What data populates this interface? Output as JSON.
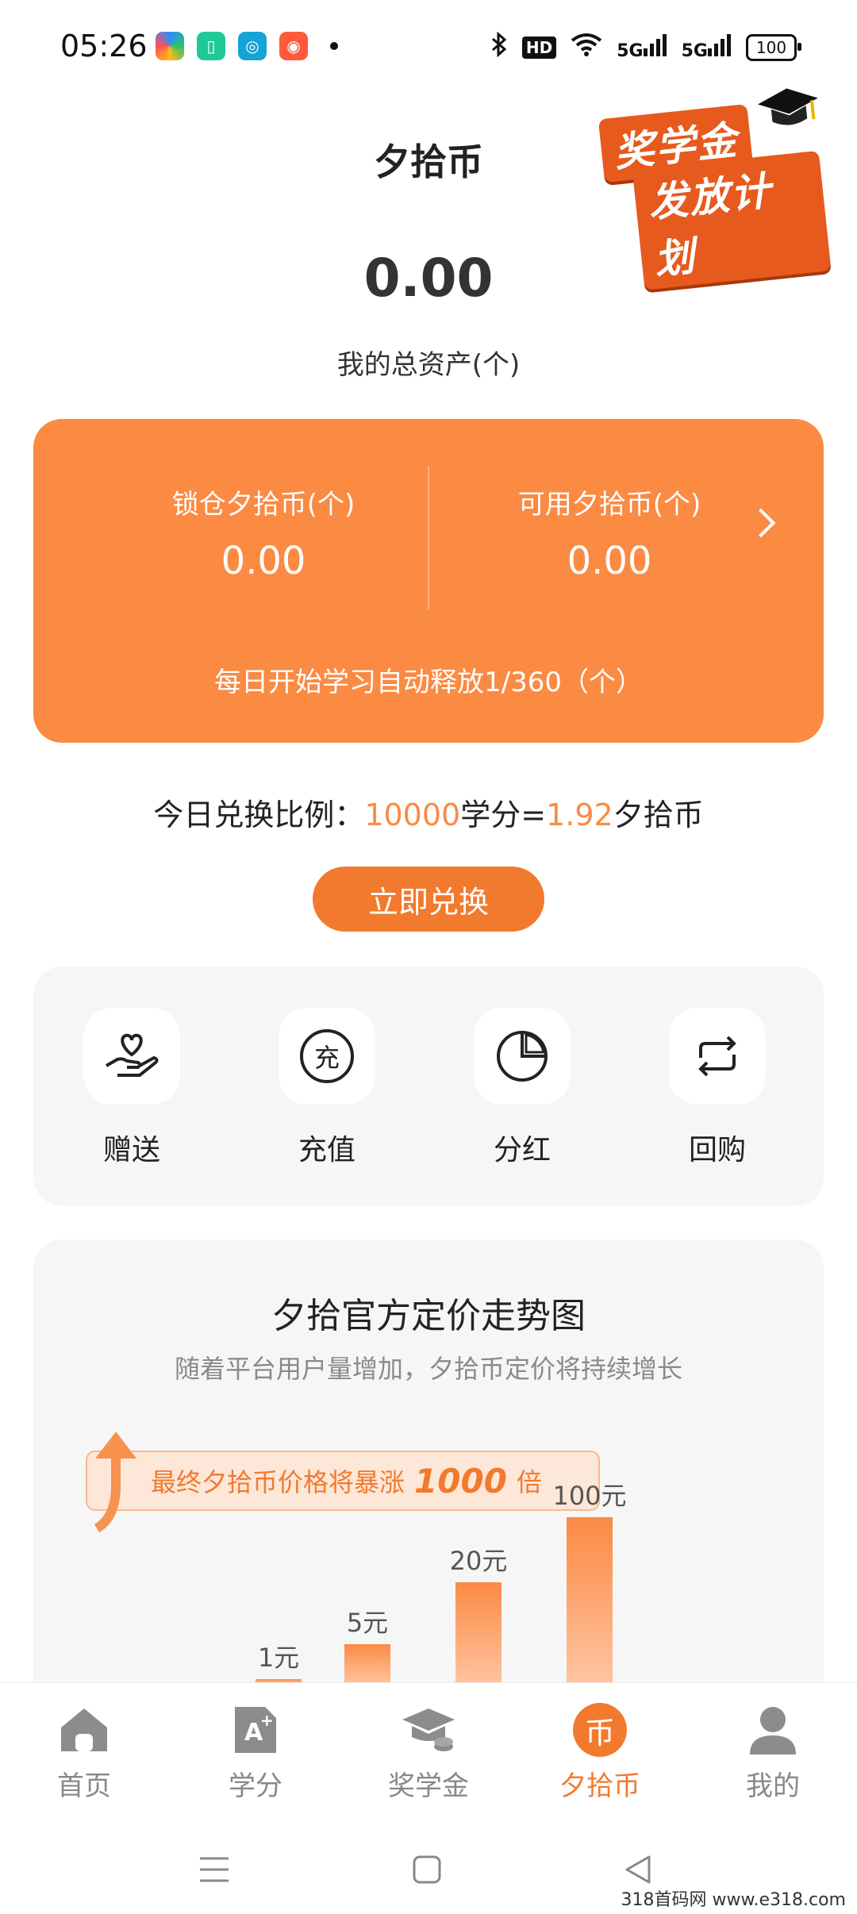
{
  "status_bar": {
    "time": "05:26",
    "notification_icons": [
      "colorful-app-icon",
      "green-app-icon",
      "teal-app-icon",
      "red-app-icon"
    ],
    "system_icons": [
      "bluetooth-icon",
      "hd-icon",
      "wifi-icon",
      "5g-signal-icon",
      "5g-signal-icon"
    ],
    "hd": "HD",
    "sig1": "5G",
    "sig2": "5G",
    "battery": "100"
  },
  "header": {
    "title": "夕拾币",
    "badge_line1": "奖学金",
    "badge_line2": "发放计划"
  },
  "assets": {
    "total_value": "0.00",
    "total_label": "我的总资产(个)"
  },
  "coin_card": {
    "locked_label": "锁仓夕拾币(个)",
    "locked_value": "0.00",
    "available_label": "可用夕拾币(个)",
    "available_value": "0.00",
    "release_note": "每日开始学习自动释放1/360（个）",
    "accent_color": "#fb8a43"
  },
  "exchange": {
    "rate_prefix": "今日兑换比例：",
    "rate_credits": "10000",
    "rate_unit": "学分=",
    "rate_coins": "1.92",
    "rate_suffix": "夕拾币",
    "button_label": "立即兑换"
  },
  "actions": [
    {
      "label": "赠送",
      "icon": "heart-hand-icon"
    },
    {
      "label": "充值",
      "icon": "recharge-icon",
      "glyph": "充"
    },
    {
      "label": "分红",
      "icon": "pie-chart-icon"
    },
    {
      "label": "回购",
      "icon": "buyback-icon"
    }
  ],
  "trend": {
    "title": "夕拾官方定价走势图",
    "subtitle": "随着平台用户量增加，夕拾币定价将持续增长",
    "banner_prefix": "最终夕拾币价格将暴涨",
    "banner_multiplier": "1000",
    "banner_suffix": "倍"
  },
  "chart_data": {
    "type": "bar",
    "categories": [
      "",
      "",
      "",
      ""
    ],
    "values": [
      1,
      5,
      20,
      100
    ],
    "value_labels": [
      "1元",
      "5元",
      "20元",
      "100元"
    ],
    "title": "",
    "xlabel": "",
    "ylabel": ""
  },
  "bottom_nav": [
    {
      "label": "首页",
      "icon": "home-icon",
      "active": false
    },
    {
      "label": "学分",
      "icon": "credit-icon",
      "active": false
    },
    {
      "label": "奖学金",
      "icon": "graduation-cap-icon",
      "active": false
    },
    {
      "label": "夕拾币",
      "icon": "coin-icon",
      "glyph": "币",
      "active": true
    },
    {
      "label": "我的",
      "icon": "profile-icon",
      "active": false
    }
  ],
  "watermark": "318首码网  www.e318.com"
}
